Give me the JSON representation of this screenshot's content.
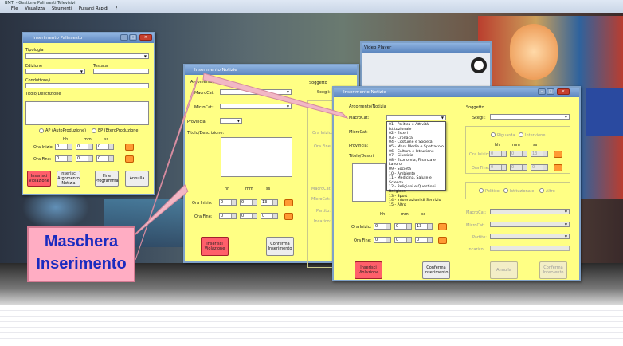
{
  "app": {
    "title": "BMTI - Gestione Palinsesti Televisivi",
    "menu": [
      "File",
      "Visualizza",
      "Strumenti",
      "Pulsanti Rapidi",
      "?"
    ]
  },
  "callout": {
    "line1": "Maschera",
    "line2": "Inserimento"
  },
  "video_player": {
    "title": "Video Player"
  },
  "win1": {
    "title": "Inserimento Palinsesto",
    "tipologia": "Tipologia",
    "edizione": "Edizione",
    "testata": "Testata",
    "conduttore": "Conduttore/i",
    "titolo": "Titolo/Descrizione",
    "ap": "AP (AutoProduzione)",
    "ep": "EP (EteroProduzione)",
    "hh": "hh",
    "mm": "mm",
    "ss": "ss",
    "ora_inizio": "Ora Inizio:",
    "ora_fine": "Ora Fine:",
    "zero": "0",
    "btn_violazione": "Inserisci Violazione",
    "btn_argomento": "Inserisci Argomento Notizia",
    "btn_fine": "Fine Programma",
    "btn_annulla": "Annulla"
  },
  "win2": {
    "title": "Inserimento Notizie",
    "argomento": "Argomento/Notizia",
    "macrocat": "MacroCat:",
    "microcat": "MicroCat:",
    "provincia": "Provincia:",
    "titolo": "Titolo/Descrizione:",
    "soggetto": "Soggetto",
    "scegli": "Scegli:",
    "ora_inizio_r": "Ora Inizio:",
    "ora_fine_r": "Ora Fine:",
    "partito": "Partito:",
    "incarico": "Incarico:",
    "hh": "hh",
    "mm": "mm",
    "ss": "ss",
    "ora_inizio": "Ora Inizio:",
    "ora_fine": "Ora Fine:",
    "zero": "0",
    "thirteen": "13",
    "btn_violazione": "Inserisci Violazione",
    "btn_conferma": "Conferma Inserimento"
  },
  "win3": {
    "title": "Inserimento Notizie",
    "argomento": "Argomento/Notizia",
    "macrocat": "MacroCat:",
    "microcat": "MicroCat:",
    "provincia": "Provincia:",
    "titolo": "Titolo/Descri",
    "soggetto": "Soggetto",
    "scegli": "Scegli:",
    "riguarda": "Riguarda",
    "interviene": "Interviene",
    "hh": "hh",
    "mm": "mm",
    "ss": "ss",
    "ora_inizio": "Ora Inizio:",
    "ora_fine": "Ora Fine:",
    "zero": "0",
    "thirteen": "13",
    "politico": "Politico",
    "istituzionale": "Istituzionale",
    "altro": "Altro",
    "macrocat_r": "MacroCat:",
    "microcat_r": "MicroCat:",
    "partito": "Partito:",
    "incarico": "Incarico:",
    "btn_violazione": "Inserisci Violazione",
    "btn_conferma": "Conferma Inserimento",
    "btn_annulla": "Annulla",
    "btn_conferma_int": "Conferma Intervento",
    "dropdown": [
      "01 - Politica e Attività Istituzionale",
      "02 - Esteri",
      "03 - Cronaca",
      "04 - Costume e Società",
      "05 - Mass Media e Spettacolo",
      "06 - Cultura e Istruzione",
      "07 - Giustizia",
      "08 - Economia, Finanza e Lavoro",
      "09 - Società",
      "10 - Ambiente",
      "11 - Medicina, Salute e Scienza",
      "12 - Religioni e Questioni Religiose",
      "13 - Sport",
      "14 - Informazioni di Servizio",
      "15 - Altro"
    ]
  },
  "colors": {
    "form_bg": "#ffff84",
    "title_bar": "#5c86bf",
    "red_button": "#ff5f6a",
    "orange_button": "#ff9a33",
    "callout_bg": "#ffadc3",
    "callout_text": "#1a2bbf"
  }
}
